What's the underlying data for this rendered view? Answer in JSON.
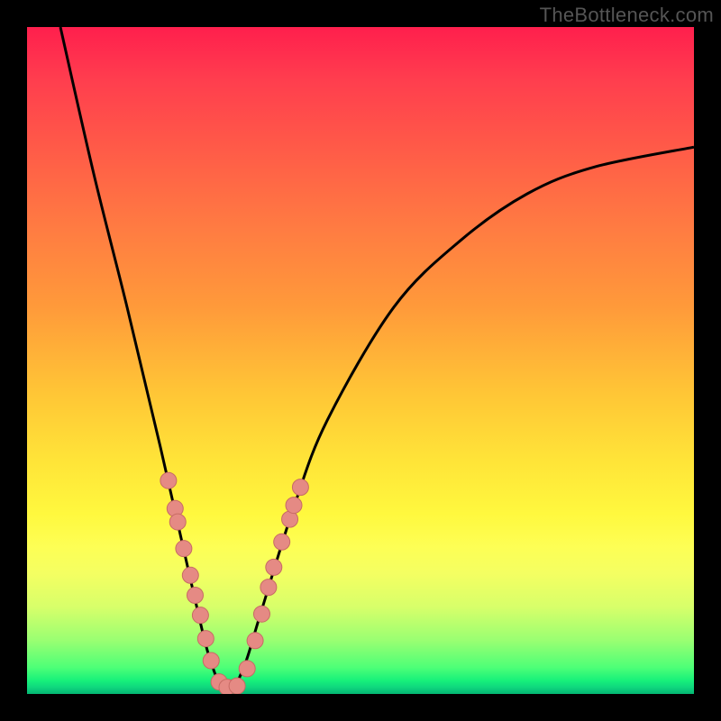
{
  "watermark": "TheBottleneck.com",
  "chart_data": {
    "type": "line",
    "title": "",
    "xlabel": "",
    "ylabel": "",
    "xlim": [
      0,
      1
    ],
    "ylim": [
      0,
      1
    ],
    "series": [
      {
        "name": "curve",
        "x": [
          0.05,
          0.1,
          0.15,
          0.2,
          0.25,
          0.275,
          0.3,
          0.325,
          0.35,
          0.4,
          0.45,
          0.55,
          0.65,
          0.75,
          0.85,
          1.0
        ],
        "y": [
          1.0,
          0.78,
          0.58,
          0.37,
          0.15,
          0.05,
          0.0,
          0.04,
          0.12,
          0.28,
          0.41,
          0.58,
          0.68,
          0.75,
          0.79,
          0.82
        ]
      }
    ],
    "markers": [
      {
        "x": 0.212,
        "y": 0.32
      },
      {
        "x": 0.222,
        "y": 0.278
      },
      {
        "x": 0.226,
        "y": 0.258
      },
      {
        "x": 0.235,
        "y": 0.218
      },
      {
        "x": 0.245,
        "y": 0.178
      },
      {
        "x": 0.252,
        "y": 0.148
      },
      {
        "x": 0.26,
        "y": 0.118
      },
      {
        "x": 0.268,
        "y": 0.083
      },
      {
        "x": 0.276,
        "y": 0.05
      },
      {
        "x": 0.288,
        "y": 0.018
      },
      {
        "x": 0.3,
        "y": 0.01
      },
      {
        "x": 0.315,
        "y": 0.012
      },
      {
        "x": 0.33,
        "y": 0.038
      },
      {
        "x": 0.342,
        "y": 0.08
      },
      {
        "x": 0.352,
        "y": 0.12
      },
      {
        "x": 0.362,
        "y": 0.16
      },
      {
        "x": 0.37,
        "y": 0.19
      },
      {
        "x": 0.382,
        "y": 0.228
      },
      {
        "x": 0.394,
        "y": 0.262
      },
      {
        "x": 0.4,
        "y": 0.283
      },
      {
        "x": 0.41,
        "y": 0.31
      }
    ],
    "colors": {
      "curve": "#000000",
      "marker_fill": "#e58a84",
      "marker_stroke": "#c76b64",
      "gradient_top": "#ff1f4d",
      "gradient_bottom": "#04b673"
    }
  }
}
